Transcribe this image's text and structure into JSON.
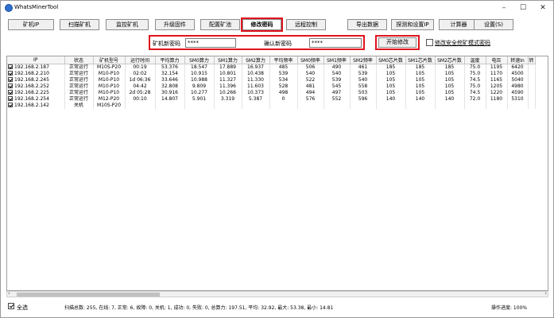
{
  "window": {
    "title": "WhatsMinerTool",
    "min": "–",
    "max": "☐",
    "close": "✕"
  },
  "toolbar": [
    {
      "id": "miner-ip",
      "label": "矿机IP"
    },
    {
      "id": "scan",
      "label": "扫描矿机"
    },
    {
      "id": "monitor",
      "label": "监控矿机"
    },
    {
      "id": "upgrade",
      "label": "升级固件"
    },
    {
      "id": "config",
      "label": "配置矿池"
    },
    {
      "id": "change-pw",
      "label": "修改密码"
    },
    {
      "id": "remote",
      "label": "远程控制"
    },
    {
      "id": "export",
      "label": "导出数据"
    },
    {
      "id": "detect-ip",
      "label": "探测和设置IP"
    },
    {
      "id": "calculator",
      "label": "计算器"
    },
    {
      "id": "settings",
      "label": "设置(S)"
    }
  ],
  "password": {
    "new_label": "矿机新密码",
    "new_value": "****",
    "confirm_label": "确认新密码",
    "confirm_value": "****",
    "start_label": "开始修改",
    "safe_mode_label": "修改安全挖矿模式密码"
  },
  "table": {
    "headers": [
      "IP",
      "状态",
      "矿机型号",
      "运行时间",
      "平均算力",
      "SM0算力",
      "SM1算力",
      "SM2算力",
      "平均频率",
      "SM0频率",
      "SM1频率",
      "SM2频率",
      "SM0芯片数",
      "SM1芯片数",
      "SM2芯片数",
      "温度",
      "电压",
      "转速In",
      "转"
    ],
    "rows": [
      [
        "192.168.2.187",
        "正常运行",
        "M10S-P20",
        "00:19",
        "53.376",
        "18.547",
        "17.889",
        "16.937",
        "485",
        "506",
        "490",
        "461",
        "185",
        "185",
        "185",
        "75.0",
        "1195",
        "6420",
        ""
      ],
      [
        "192.168.2.210",
        "正常运行",
        "M10-P10",
        "02:02",
        "32.154",
        "10.915",
        "10.801",
        "10.438",
        "539",
        "540",
        "540",
        "539",
        "105",
        "105",
        "105",
        "75.0",
        "1170",
        "4500",
        ""
      ],
      [
        "192.168.2.245",
        "正常运行",
        "M10-P10",
        "1d 06:36",
        "33.646",
        "10.988",
        "11.327",
        "11.330",
        "534",
        "522",
        "539",
        "540",
        "105",
        "105",
        "105",
        "74.5",
        "1165",
        "5040",
        ""
      ],
      [
        "192.168.2.252",
        "正常运行",
        "M10-P10",
        "04:42",
        "32.808",
        "9.809",
        "11.396",
        "11.603",
        "528",
        "481",
        "545",
        "558",
        "105",
        "105",
        "105",
        "75.0",
        "1205",
        "4980",
        ""
      ],
      [
        "192.168.2.225",
        "正常运行",
        "M10-P10",
        "2d 05:28",
        "30.916",
        "10.277",
        "10.266",
        "10.373",
        "498",
        "494",
        "497",
        "503",
        "105",
        "105",
        "105",
        "74.5",
        "1220",
        "4590",
        ""
      ],
      [
        "192.168.2.254",
        "正常运行",
        "M12-P20",
        "00:10",
        "14.807",
        "5.901",
        "3.319",
        "5.387",
        "0",
        "576",
        "552",
        "596",
        "140",
        "140",
        "140",
        "72.0",
        "1180",
        "5310",
        ""
      ],
      [
        "192.168.2.142",
        "关机",
        "M10S-P20",
        "",
        "",
        "",
        "",
        "",
        "",
        "",
        "",
        "",
        "",
        "",
        "",
        "",
        "",
        "",
        ""
      ]
    ]
  },
  "status": {
    "select_all": "全选",
    "summary": "扫描总数: 255, 在线: 7, 正常: 6, 故障: 0, 关机: 1, 成功: 0, 失败: 0, 总算力: 197.51, 平均: 32.92, 最大: 53.38, 最小: 14.81",
    "progress": "操作进度: 100%"
  },
  "colors": {
    "highlight": "#e0141e"
  }
}
